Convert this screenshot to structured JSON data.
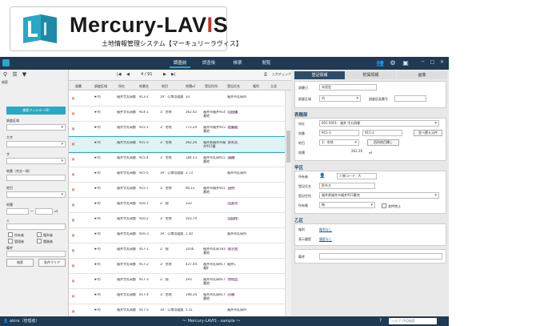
{
  "logo": {
    "name_main": "Mercury-LAV",
    "name_red": "I",
    "name_end": "S",
    "subtitle": "土地情報管理システム【マーキュリーラヴィス】"
  },
  "nav": [
    "調査前",
    "調査後",
    "帳票",
    "閲覧"
  ],
  "left": {
    "title": "検索",
    "filter_button": "検索フィルター(0)",
    "labels": [
      "調査区域",
      "大字",
      "字",
      "地番（完全一致）",
      "地目",
      "地積",
      "人",
      "備考"
    ],
    "range_sep": "～",
    "range_unit": "㎡",
    "checks": [
      "所有者",
      "権利者",
      "管理者",
      "農業者"
    ],
    "search_button": "検索",
    "clear_button": "条件クリア"
  },
  "grid_toolbar": {
    "page": "4 / 91",
    "entry": "入力チェック"
  },
  "grid_headers": [
    "調書",
    "調査区域",
    "所在",
    "地番名",
    "地目",
    "地積㎡",
    "登記住所",
    "登記氏名",
    "権利",
    "立会"
  ],
  "grid_rows": [
    {
      "area": "内",
      "loc": "福井字丸岡都",
      "num": "913-2",
      "moku": "19：公衆用道路",
      "seki": "33",
      "addr": "",
      "name": "福井市丸岡市",
      "hl": false
    },
    {
      "area": "内",
      "loc": "福井字丸岡都",
      "num": "914-1",
      "moku": "3：宅地",
      "seki": "362.45",
      "addr": "福井市福井914番地",
      "name": "山田谦",
      "hl": true
    },
    {
      "area": "内",
      "loc": "福井字丸岡都",
      "num": "915-1",
      "moku": "3：宅地",
      "seki": "772.24",
      "addr": "福井市福井915番地",
      "name": "佐藤夏",
      "hl": true
    },
    {
      "area": "内",
      "loc": "福井字丸岡都",
      "num": "915-3",
      "moku": "3：宅地",
      "seki": "262.26",
      "addr": "福井県福井市福井915番",
      "name": "鈴木太",
      "hl": true
    },
    {
      "area": "内",
      "loc": "福井字丸岡都",
      "num": "915-4",
      "moku": "3：宅地",
      "seki": "184.53",
      "addr": "福井市丸岡915番地",
      "name": "高橋",
      "hl": true
    },
    {
      "area": "内",
      "loc": "福井字丸岡都",
      "num": "915-5",
      "moku": "19：公衆用道路",
      "seki": "2.73",
      "addr": "",
      "name": "福井市丸岡市",
      "hl": false
    },
    {
      "area": "内",
      "loc": "福井字丸岡都",
      "num": "915-7",
      "moku": "3：宅地",
      "seki": "66.13",
      "addr": "福井市福井915番地",
      "name": "田中",
      "hl": true
    },
    {
      "area": "内",
      "loc": "福井字丸岡都",
      "num": "916-1",
      "moku": "2：畑",
      "seki": "333",
      "addr": "",
      "name": "山本子",
      "hl": true
    },
    {
      "area": "内",
      "loc": "福井字丸岡都",
      "num": "916-2",
      "moku": "3：宅地",
      "seki": "503.74",
      "addr": "",
      "name": "山田作",
      "hl": true
    },
    {
      "area": "内",
      "loc": "福井字丸岡都",
      "num": "916-3",
      "moku": "19：公衆用道路",
      "seki": "1.30",
      "addr": "",
      "name": "福井市丸岡市",
      "hl": false
    },
    {
      "area": "内",
      "loc": "福井字丸岡都",
      "num": "917-1",
      "moku": "2：畑",
      "seki": "1036",
      "addr": "福井市丸岡783番地",
      "name": "木下文",
      "hl": true
    },
    {
      "area": "内",
      "loc": "福井字丸岡都",
      "num": "917-2",
      "moku": "3：宅地",
      "seki": "437.44",
      "addr": "福井市丸岡917番8",
      "name": "福井C",
      "hl": false
    },
    {
      "area": "内",
      "loc": "福井字丸岡都",
      "num": "917-3",
      "moku": "2：畑",
      "seki": "293",
      "addr": "福井市丸岡917番地",
      "name": "中村之",
      "hl": true
    },
    {
      "area": "内",
      "loc": "福井字丸岡都",
      "num": "917-4",
      "moku": "3：宅地",
      "seki": "198.34",
      "addr": "福井市丸岡917番地",
      "name": "小林",
      "hl": true
    },
    {
      "area": "内",
      "loc": "福井字丸岡都",
      "num": "917-5",
      "moku": "19：公衆用道路",
      "seki": "5.51",
      "addr": "",
      "name": "福井市丸岡市",
      "hl": false
    },
    {
      "area": "内",
      "loc": "福井字丸岡都",
      "num": "917-6",
      "moku": "19：公衆用道路",
      "seki": "1.21",
      "addr": "",
      "name": "福井市丸岡市",
      "hl": false
    }
  ],
  "right": {
    "tabs": [
      "登記情報",
      "附属情報",
      "画像"
    ],
    "top": {
      "chosho": "調書日",
      "chosho_val": "未設定",
      "area": "調査区域",
      "area_val": "内",
      "area_no": "調査区画番号"
    },
    "hyoji": {
      "title": "表題部",
      "shozai": "所在",
      "shozai_val": "001 0001：福井 字丸岡都",
      "chiban": "地番",
      "chiban_a": "915-3",
      "chiban_b": "915-3",
      "chiban_btn": "並べ替え元件",
      "chimoku": "地目",
      "chimoku_val": "3：宅地",
      "chimoku_btn": "西所地目積し",
      "chiseki": "地積",
      "chiseki_val": "262.26",
      "chiseki_unit": "㎡"
    },
    "kouku": {
      "title": "甲区",
      "owner": "所有者",
      "owner_code": "人物コード：A",
      "name": "登記氏名",
      "name_val": "鈴木大",
      "addr": "登記住所",
      "addr_val": "福井県福井市福井915番地",
      "kenri": "所有権",
      "kenri_val": "無",
      "chk": "差押禁止"
    },
    "otsuku": {
      "title": "乙区",
      "kenri": "権利",
      "kenri_val": "権利なし",
      "hyoji": "表示履歴",
      "hyoji_val": "履歴なし"
    },
    "biko": {
      "label": "備考"
    }
  },
  "status": {
    "user": "akira（管理者）",
    "center": "～ Mercury-LAVIS - sample ～",
    "search_ph": "ヘルプ･FAQ検索"
  },
  "colors": {
    "navy": "#1f3a52",
    "teal": "#2aa7c6",
    "tab_active": "#2c4b66",
    "error_x": "#c0392b"
  }
}
